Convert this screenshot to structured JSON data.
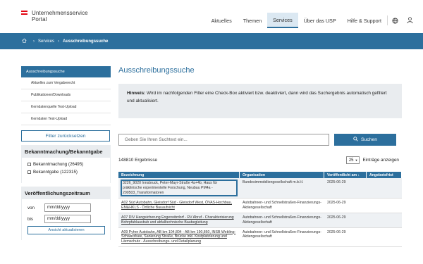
{
  "header": {
    "logo_line1": "Unternehmensservice",
    "logo_line2": "Portal",
    "nav": [
      {
        "label": "Aktuelles",
        "active": false
      },
      {
        "label": "Themen",
        "active": false
      },
      {
        "label": "Services",
        "active": true
      },
      {
        "label": "Über das USP",
        "active": false
      },
      {
        "label": "Hilfe & Support",
        "active": false
      }
    ],
    "lang": "☰",
    "colors": {
      "primary": "#2c6f9d",
      "flag_red": "#e30613"
    }
  },
  "breadcrumb": {
    "home_icon": "home-icon",
    "items": [
      "Services",
      "Ausschreibungssuche"
    ]
  },
  "sidebar": {
    "active": "Ausschreibungssuche",
    "items": [
      "Aktuelles zum Vergaberecht",
      "Publikationen/Downloads",
      "Kerndatenquelle Test-Upload",
      "Kerndaten Test-Upload"
    ],
    "reset_label": "Filter zurücksetzen",
    "section1_title": "Bekanntmachung/Bekanntgabe",
    "checkboxes": [
      "Bekanntmachung (26495)",
      "Bekanntgabe (122315)"
    ],
    "section2_title": "Veröffentlichungszeitraum",
    "from_label": "von",
    "to_label": "bis",
    "date_placeholder": "mm/dd/yyyy",
    "apply_label": "Ansicht aktualisieren"
  },
  "main": {
    "title": "Ausschreibungssuche",
    "hint_bold": "Hinweis:",
    "hint_text": " Wird im nachfolgenden Filter eine Check-Box aktiviert bzw. deaktiviert, dann wird das Suchergebnis automatisch gefiltert und aktualisiert.",
    "search_placeholder": "Geben Sie Ihren Suchtext ein...",
    "search_button": "Suchen",
    "results_count": "148810 Ergebnisse",
    "per_page_value": "25",
    "per_page_label": "Einträge anzeigen",
    "columns": [
      "Bezeichnung",
      "Organisation",
      "Veröffentlicht am ↓",
      "Angebotsfrist"
    ],
    "rows": [
      {
        "name": "3226_9020 Innsbruck, Peter-Mayr-Straße 4a+4b, Haus für präklinische experimentelle Forschung, Neubau PM4a - 200503_Transformatoren",
        "org": "Bundesimmobiliengesellschaft m.b.H.",
        "date": "2025-06-29",
        "deadline": ""
      },
      {
        "name": "A02 Süd Autobahn, Gleisdorf Süd - Gleisdorf West, ÖVAS-Hochbau, EM&HKLS - Örtliche Bauaufsicht",
        "org": "Autobahnen- und Schnellstraßen-Finanzierungs-Aktiengesellschaft",
        "date": "2025-06-29",
        "deadline": ""
      },
      {
        "name": "A07 DIV Hangsicherung Engerwitzdorf - RV Abruf - Charakterisierung Bohrpfahlausbub und abfalltechnische Baubegleitung",
        "org": "Autobahnen- und Schnellstraßen-Finanzierungs-Aktiengesellschaft",
        "date": "2025-06-29",
        "deadline": ""
      },
      {
        "name": "A09 Pyhrn Autobahn, AB km 104,804 - AB km 190,860, INSB Webling-Schwarzlsee, Sanierung Straße, Brücke inkl. Kostplatzierung und Lärmschutz - Ausschreibungs- und Detailplanung",
        "org": "Autobahnen- und Schnellstraßen-Finanzierungs-Aktiengesellschaft",
        "date": "2025-06-29",
        "deadline": ""
      }
    ]
  }
}
